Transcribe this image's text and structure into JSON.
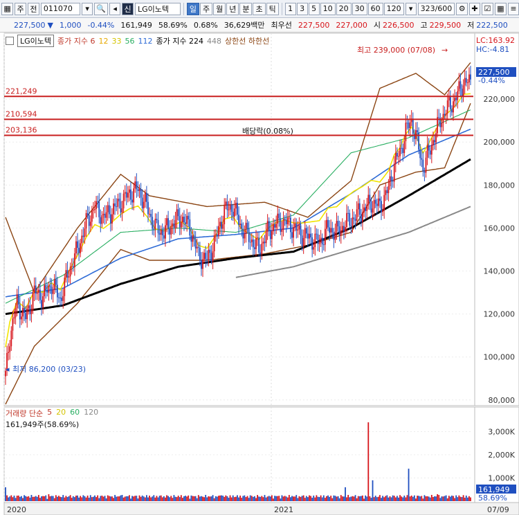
{
  "toolbar": {
    "market_type": "주",
    "market_sub": "전",
    "code": "011070",
    "name": "LG이노텍",
    "prefix_badge": "신",
    "periods": [
      "일",
      "주",
      "월",
      "년",
      "분",
      "초",
      "틱"
    ],
    "active_period": "일",
    "intervals": [
      "1",
      "3",
      "5",
      "10",
      "20",
      "30",
      "60",
      "120"
    ],
    "count": "323/600"
  },
  "quote": {
    "price": "227,500",
    "change": "1,000",
    "change_pct": "-0.44%",
    "volume": "161,949",
    "volume_ratio": "58.69%",
    "turnover_pct": "0.68%",
    "amount": "36,629백만",
    "best_label": "최우선",
    "best_ask": "227,500",
    "best_bid": "227,000",
    "open_label": "시",
    "open": "226,500",
    "high_label": "고",
    "high": "229,500",
    "low_label": "저",
    "low": "222,500"
  },
  "legend": {
    "name": "LG이노텍",
    "ma_title": "종가 지수 6",
    "ma_values": [
      "12",
      "33",
      "56",
      "112"
    ],
    "ma2_title": "종가 지수 224",
    "ma2_value": "448",
    "band_label": "상한선 하한선"
  },
  "annotations": {
    "high": "최고 239,000 (07/08)",
    "low": "최저 86,200 (03/23)",
    "dividend": "배당락(0.08%)",
    "lc": "LC:163.92",
    "hc": "HC:-4.81",
    "current_price": "227,500",
    "current_change": "-0.44%",
    "current_volume": "161,949",
    "current_volume_pct": "58.69%"
  },
  "volume_legend": {
    "title": "거래량 단순",
    "periods": [
      "5",
      "20",
      "60",
      "120"
    ],
    "current": "161,949주(58.69%)"
  },
  "colors": {
    "up": "#d7141a",
    "down": "#1f4fc0",
    "ma5": "#c0392b",
    "ma12": "#f1c40f",
    "ma33": "#f1e400",
    "ma56": "#27ae60",
    "ma112": "#2e6bd6",
    "ma224": "#000000",
    "ma448": "#888888",
    "band": "#8b4513",
    "hline": "#c81e1e"
  },
  "chart_data": {
    "type": "candlestick",
    "ylim": [
      78000,
      250000
    ],
    "y_ticks": [
      80000,
      100000,
      120000,
      140000,
      160000,
      180000,
      200000,
      220000
    ],
    "y_tick_labels": [
      "80,000",
      "100,000",
      "120,000",
      "140,000",
      "160,000",
      "180,000",
      "200,000",
      "220,000"
    ],
    "x_labels": [
      "2020",
      "2021",
      "07/09"
    ],
    "hlines": [
      {
        "value": 221249,
        "label": "221,249"
      },
      {
        "value": 210594,
        "label": "210,594"
      },
      {
        "value": 203136,
        "label": "203,136"
      }
    ],
    "close_series": [
      {
        "t": 0,
        "v": 91000
      },
      {
        "t": 3,
        "v": 110000
      },
      {
        "t": 8,
        "v": 125000
      },
      {
        "t": 14,
        "v": 118000
      },
      {
        "t": 20,
        "v": 130000
      },
      {
        "t": 26,
        "v": 128000
      },
      {
        "t": 32,
        "v": 134000
      },
      {
        "t": 38,
        "v": 127000
      },
      {
        "t": 44,
        "v": 140000
      },
      {
        "t": 50,
        "v": 150000
      },
      {
        "t": 56,
        "v": 162000
      },
      {
        "t": 62,
        "v": 170000
      },
      {
        "t": 68,
        "v": 165000
      },
      {
        "t": 74,
        "v": 168000
      },
      {
        "t": 80,
        "v": 172000
      },
      {
        "t": 86,
        "v": 176000
      },
      {
        "t": 92,
        "v": 178000
      },
      {
        "t": 98,
        "v": 170000
      },
      {
        "t": 104,
        "v": 160000
      },
      {
        "t": 110,
        "v": 158000
      },
      {
        "t": 116,
        "v": 162000
      },
      {
        "t": 122,
        "v": 165000
      },
      {
        "t": 128,
        "v": 160000
      },
      {
        "t": 134,
        "v": 147000
      },
      {
        "t": 140,
        "v": 145000
      },
      {
        "t": 146,
        "v": 155000
      },
      {
        "t": 152,
        "v": 168000
      },
      {
        "t": 158,
        "v": 170000
      },
      {
        "t": 164,
        "v": 160000
      },
      {
        "t": 170,
        "v": 155000
      },
      {
        "t": 176,
        "v": 150000
      },
      {
        "t": 182,
        "v": 158000
      },
      {
        "t": 188,
        "v": 162000
      },
      {
        "t": 194,
        "v": 163000
      },
      {
        "t": 200,
        "v": 160000
      },
      {
        "t": 206,
        "v": 157000
      },
      {
        "t": 212,
        "v": 155000
      },
      {
        "t": 218,
        "v": 153000
      },
      {
        "t": 224,
        "v": 160000
      },
      {
        "t": 230,
        "v": 158000
      },
      {
        "t": 236,
        "v": 162000
      },
      {
        "t": 242,
        "v": 165000
      },
      {
        "t": 248,
        "v": 168000
      },
      {
        "t": 254,
        "v": 172000
      },
      {
        "t": 260,
        "v": 170000
      },
      {
        "t": 266,
        "v": 178000
      },
      {
        "t": 270,
        "v": 190000
      },
      {
        "t": 274,
        "v": 195000
      },
      {
        "t": 278,
        "v": 205000
      },
      {
        "t": 282,
        "v": 210000
      },
      {
        "t": 286,
        "v": 200000
      },
      {
        "t": 290,
        "v": 188000
      },
      {
        "t": 294,
        "v": 195000
      },
      {
        "t": 298,
        "v": 203000
      },
      {
        "t": 302,
        "v": 210000
      },
      {
        "t": 306,
        "v": 215000
      },
      {
        "t": 310,
        "v": 218000
      },
      {
        "t": 314,
        "v": 222000
      },
      {
        "t": 318,
        "v": 228000
      },
      {
        "t": 323,
        "v": 227500
      }
    ],
    "ma224_series": [
      {
        "t": 0,
        "v": 120000
      },
      {
        "t": 40,
        "v": 124000
      },
      {
        "t": 80,
        "v": 134000
      },
      {
        "t": 120,
        "v": 142000
      },
      {
        "t": 160,
        "v": 146000
      },
      {
        "t": 200,
        "v": 149000
      },
      {
        "t": 240,
        "v": 160000
      },
      {
        "t": 280,
        "v": 175000
      },
      {
        "t": 323,
        "v": 192000
      }
    ],
    "ma448_series": [
      {
        "t": 160,
        "v": 137000
      },
      {
        "t": 200,
        "v": 142000
      },
      {
        "t": 240,
        "v": 150000
      },
      {
        "t": 280,
        "v": 158000
      },
      {
        "t": 323,
        "v": 170000
      }
    ],
    "ma112_series": [
      {
        "t": 0,
        "v": 128000
      },
      {
        "t": 40,
        "v": 132000
      },
      {
        "t": 80,
        "v": 146000
      },
      {
        "t": 120,
        "v": 155000
      },
      {
        "t": 160,
        "v": 157000
      },
      {
        "t": 200,
        "v": 160000
      },
      {
        "t": 240,
        "v": 176000
      },
      {
        "t": 280,
        "v": 194000
      },
      {
        "t": 323,
        "v": 206000
      }
    ],
    "ma56_series": [
      {
        "t": 0,
        "v": 125000
      },
      {
        "t": 40,
        "v": 138000
      },
      {
        "t": 80,
        "v": 158000
      },
      {
        "t": 120,
        "v": 160000
      },
      {
        "t": 160,
        "v": 158000
      },
      {
        "t": 200,
        "v": 166000
      },
      {
        "t": 240,
        "v": 195000
      },
      {
        "t": 280,
        "v": 202000
      },
      {
        "t": 323,
        "v": 215000
      }
    ],
    "band_upper_series": [
      {
        "t": 0,
        "v": 165000
      },
      {
        "t": 20,
        "v": 130000
      },
      {
        "t": 50,
        "v": 160000
      },
      {
        "t": 80,
        "v": 185000
      },
      {
        "t": 100,
        "v": 175000
      },
      {
        "t": 140,
        "v": 170000
      },
      {
        "t": 180,
        "v": 172000
      },
      {
        "t": 210,
        "v": 165000
      },
      {
        "t": 240,
        "v": 182000
      },
      {
        "t": 260,
        "v": 225000
      },
      {
        "t": 285,
        "v": 232000
      },
      {
        "t": 305,
        "v": 222000
      },
      {
        "t": 323,
        "v": 237000
      }
    ],
    "band_lower_series": [
      {
        "t": 0,
        "v": 78000
      },
      {
        "t": 20,
        "v": 105000
      },
      {
        "t": 50,
        "v": 125000
      },
      {
        "t": 80,
        "v": 150000
      },
      {
        "t": 100,
        "v": 145000
      },
      {
        "t": 140,
        "v": 145000
      },
      {
        "t": 180,
        "v": 148000
      },
      {
        "t": 210,
        "v": 152000
      },
      {
        "t": 240,
        "v": 158000
      },
      {
        "t": 260,
        "v": 180000
      },
      {
        "t": 285,
        "v": 186000
      },
      {
        "t": 305,
        "v": 188000
      },
      {
        "t": 323,
        "v": 218000
      }
    ],
    "volume": {
      "ylim": [
        0,
        4000000
      ],
      "y_ticks": [
        1000000,
        2000000,
        3000000
      ],
      "y_tick_labels": [
        "1,000K",
        "2,000K",
        "3,000K"
      ],
      "spikes": [
        {
          "t": 0,
          "v": 600000
        },
        {
          "t": 30,
          "v": 300000
        },
        {
          "t": 80,
          "v": 250000
        },
        {
          "t": 150,
          "v": 250000
        },
        {
          "t": 200,
          "v": 200000
        },
        {
          "t": 236,
          "v": 600000
        },
        {
          "t": 252,
          "v": 3400000
        },
        {
          "t": 255,
          "v": 900000
        },
        {
          "t": 280,
          "v": 1400000
        },
        {
          "t": 300,
          "v": 300000
        },
        {
          "t": 323,
          "v": 161949
        }
      ]
    }
  }
}
